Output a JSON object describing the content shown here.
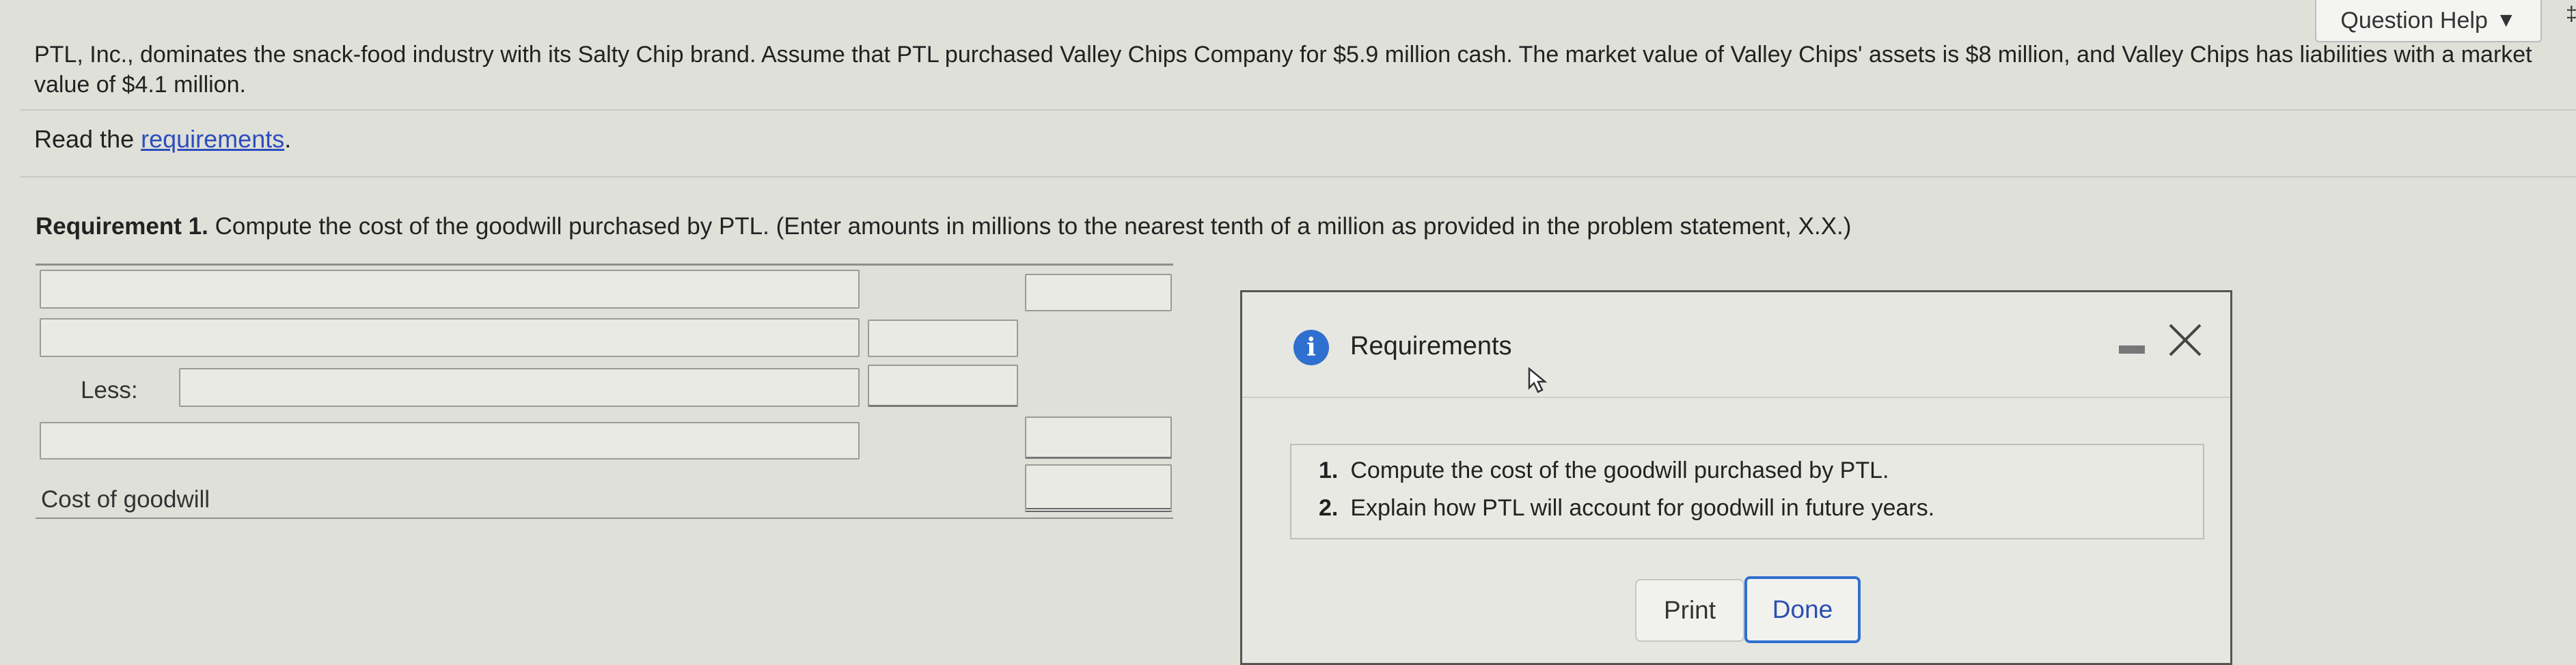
{
  "header": {
    "question_help": "Question Help",
    "edge_glyph": "‡"
  },
  "problem": {
    "text": "PTL, Inc., dominates the snack-food industry with its Salty Chip brand. Assume that PTL purchased Valley Chips Company for $5.9 million cash. The market value of Valley Chips' assets is $8 million, and Valley Chips has liabilities with a market value of $4.1 million.",
    "read_prefix": "Read the ",
    "read_link": "requirements",
    "read_suffix": "."
  },
  "requirement": {
    "label": "Requirement 1.",
    "text": " Compute the cost of the goodwill purchased by PTL. (Enter amounts in millions to the nearest tenth of a million as provided in the problem statement, X.X.)"
  },
  "table": {
    "rows": [
      {
        "label": "",
        "input1": "",
        "input2": "",
        "total": ""
      },
      {
        "label": "",
        "input1": "",
        "input2": ""
      },
      {
        "label": "Less:",
        "input1": "",
        "input2": ""
      },
      {
        "label": "",
        "input1": "",
        "total": ""
      },
      {
        "label": "Cost of goodwill",
        "total": ""
      }
    ]
  },
  "dialog": {
    "title": "Requirements",
    "info_icon": "info-icon",
    "items": [
      {
        "num": "1.",
        "text": "Compute the cost of the goodwill purchased by PTL."
      },
      {
        "num": "2.",
        "text": "Explain how PTL will account for goodwill in future years."
      }
    ],
    "print_label": "Print",
    "done_label": "Done",
    "accent_color": "#2f6fd0"
  }
}
